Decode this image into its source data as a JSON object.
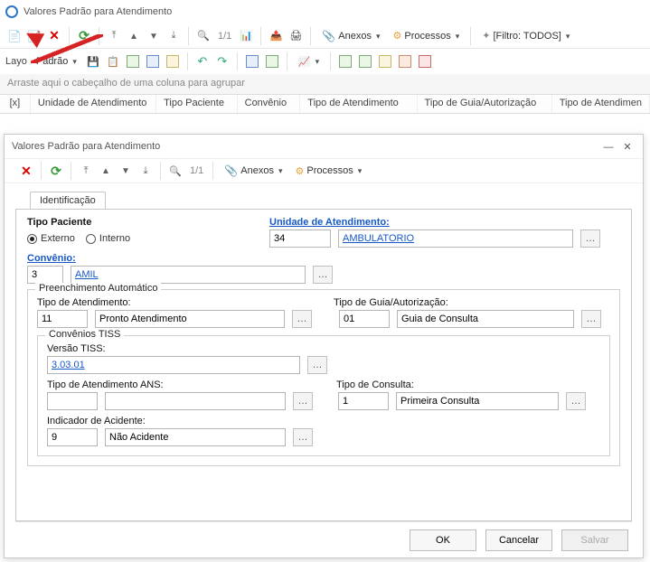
{
  "main": {
    "title": "Valores Padrão para Atendimento",
    "pager": "1/1",
    "anexos_label": "Anexos",
    "processos_label": "Processos",
    "filtro_label": "[Filtro: TODOS]",
    "layout_label": "Layo",
    "layout_dropdown": "Padrão",
    "group_hint": "Arraste aqui o cabeçalho de uma coluna para agrupar",
    "columns": {
      "x": "[x]",
      "c1": "Unidade de Atendimento",
      "c2": "Tipo Paciente",
      "c3": "Convênio",
      "c4": "Tipo de Atendimento",
      "c5": "Tipo de Guia/Autorização",
      "c6": "Tipo de Atendimen"
    }
  },
  "modal": {
    "title": "Valores Padrão para Atendimento",
    "pager": "1/1",
    "anexos_label": "Anexos",
    "processos_label": "Processos",
    "tab": "Identificação",
    "tipo_paciente_label": "Tipo Paciente",
    "externo_label": "Externo",
    "interno_label": "Interno",
    "unidade_label": "Unidade de Atendimento:",
    "unidade_code": "34",
    "unidade_name": "AMBULATORIO",
    "convenio_label": "Convênio:",
    "convenio_code": "3",
    "convenio_name": "AMIL",
    "preench_group": "Preenchimento Automático",
    "tipo_atend_label": "Tipo de Atendimento:",
    "tipo_atend_code": "11",
    "tipo_atend_name": "Pronto Atendimento",
    "tipo_guia_label": "Tipo de Guia/Autorização:",
    "tipo_guia_code": "01",
    "tipo_guia_name": "Guia de Consulta",
    "tiss_group": "Convênios TISS",
    "versao_label": "Versão TISS:",
    "versao_value": "3.03.01",
    "atend_ans_label": "Tipo de Atendimento ANS:",
    "atend_ans_code": "",
    "atend_ans_name": "",
    "tipo_consulta_label": "Tipo de Consulta:",
    "tipo_consulta_code": "1",
    "tipo_consulta_name": "Primeira Consulta",
    "indicador_label": "Indicador de Acidente:",
    "indicador_code": "9",
    "indicador_name": "Não Acidente",
    "btn_ok": "OK",
    "btn_cancel": "Cancelar",
    "btn_save": "Salvar"
  }
}
